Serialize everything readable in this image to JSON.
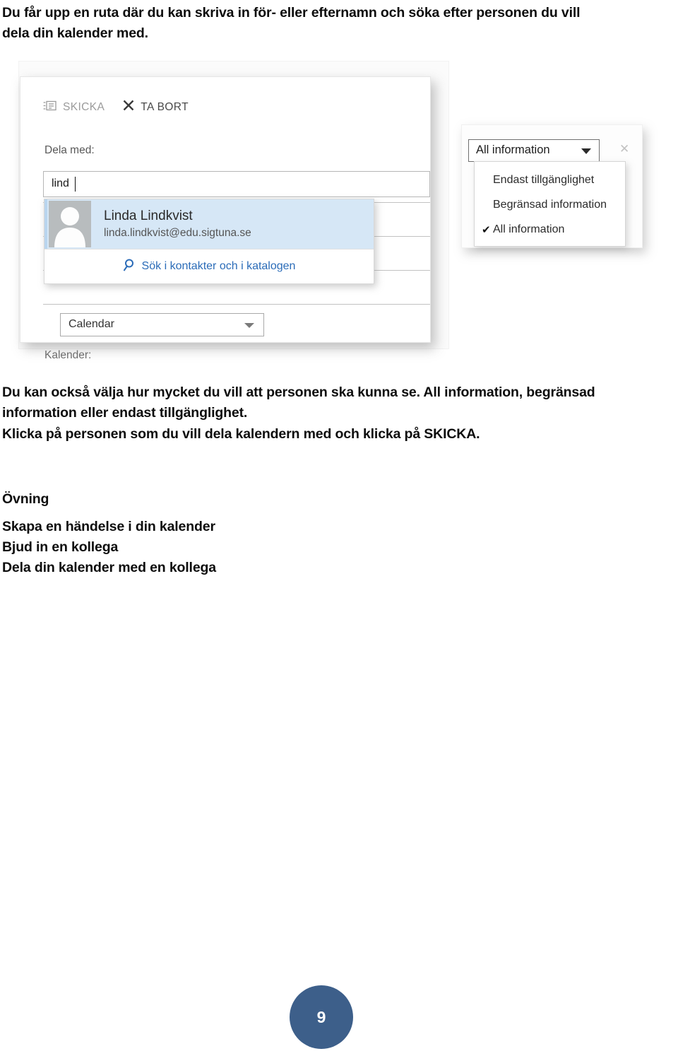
{
  "document": {
    "intro_paragraph_line1": "Du får upp en ruta där du kan skriva in för- eller efternamn och söka efter personen du vill",
    "intro_paragraph_line2": "dela din kalender med.",
    "explain_line1": "Du kan också välja hur mycket du vill att personen ska kunna se. All information, begränsad",
    "explain_line2": "information eller endast tillgänglighet.",
    "click_line": "Klicka på personen som du vill dela kalendern med och klicka på SKICKA.",
    "exercise_heading": "Övning",
    "exercise_items": [
      "Skapa en händelse i din kalender",
      "Bjud in en kollega",
      "Dela din kalender med en kollega"
    ],
    "page_number": "9"
  },
  "share_dialog": {
    "toolbar": {
      "send_label": "SKICKA",
      "send_icon": "send-icon",
      "delete_label": "TA BORT",
      "delete_icon": "close-x-icon"
    },
    "share_with_label": "Dela med:",
    "share_with_value": "lind",
    "suggestion": {
      "avatar_icon": "person-avatar-icon",
      "name": "Linda Lindkvist",
      "email": "linda.lindkvist@edu.sigtuna.se",
      "search_link_label": "Sök i kontakter och i katalogen",
      "search_icon": "search-icon"
    },
    "calendar_label": "Kalender:",
    "calendar_value": "Calendar",
    "calendar_dropdown_icon": "chevron-down-icon"
  },
  "permission_flyout": {
    "selected_value": "All information",
    "dropdown_icon": "chevron-down-icon",
    "close_icon": "close-icon",
    "options": [
      {
        "label": "Endast tillgänglighet",
        "checked": false
      },
      {
        "label": "Begränsad information",
        "checked": false
      },
      {
        "label": "All information",
        "checked": true
      }
    ],
    "check_glyph": "✔"
  },
  "colors": {
    "page_badge": "#3d5f8a",
    "link_blue": "#2b6cb8",
    "suggestion_highlight": "#d6e7f6"
  }
}
